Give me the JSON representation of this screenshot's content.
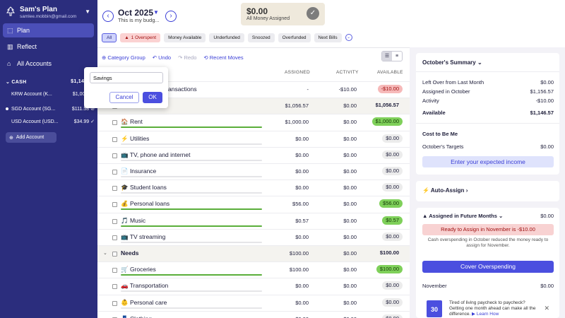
{
  "sidebar": {
    "plan_name": "Sam's Plan",
    "email": "samlee.mobbin@gmail.com",
    "nav": [
      {
        "label": "Plan",
        "icon": "plan-icon"
      },
      {
        "label": "Reflect",
        "icon": "bar-chart-icon"
      },
      {
        "label": "All Accounts",
        "icon": "bank-icon"
      }
    ],
    "cash_label": "CASH",
    "cash_total": "$1,146.57",
    "accounts": [
      {
        "name": "KRW Account (K...",
        "balance": "$1,000.00",
        "status": ""
      },
      {
        "name": "SGD Account (SG...",
        "balance": "$111.58",
        "status": "reconciling-icon"
      },
      {
        "name": "USD Account (USD...",
        "balance": "$34.99",
        "status": "check-icon"
      }
    ],
    "add_account": "Add Account"
  },
  "header": {
    "month": "Oct 2025",
    "note": "This is my budg...",
    "assigned_amount": "$0.00",
    "assigned_label": "All Money Assigned"
  },
  "filters": [
    {
      "label": "All",
      "selected": true
    },
    {
      "label": "1 Overspent",
      "warn": true
    },
    {
      "label": "Money Available"
    },
    {
      "label": "Underfunded"
    },
    {
      "label": "Snoozed"
    },
    {
      "label": "Overfunded"
    },
    {
      "label": "Next Bills"
    }
  ],
  "toolbar": {
    "category_group": "Category Group",
    "undo": "Undo",
    "redo": "Redo",
    "recent_moves": "Recent Moves"
  },
  "columns": {
    "assigned": "ASSIGNED",
    "activity": "ACTIVITY",
    "available": "AVAILABLE"
  },
  "rows": [
    {
      "type": "item",
      "name": "ansactions",
      "assigned": "-",
      "activity": "-$10.00",
      "available": "-$10.00",
      "avail_style": "neg"
    },
    {
      "type": "group",
      "name": "",
      "assigned": "$1,056.57",
      "activity": "$0.00",
      "available": "$1,056.57"
    },
    {
      "type": "item",
      "name": "🏠 Rent",
      "assigned": "$1,000.00",
      "activity": "$0.00",
      "available": "$1,000.00",
      "avail_style": "pos",
      "bar": "green"
    },
    {
      "type": "item",
      "name": "⚡ Utilities",
      "assigned": "$0.00",
      "activity": "$0.00",
      "available": "$0.00"
    },
    {
      "type": "item",
      "name": "📺 TV, phone and internet",
      "assigned": "$0.00",
      "activity": "$0.00",
      "available": "$0.00"
    },
    {
      "type": "item",
      "name": "📄 Insurance",
      "assigned": "$0.00",
      "activity": "$0.00",
      "available": "$0.00"
    },
    {
      "type": "item",
      "name": "🎓 Student loans",
      "assigned": "$0.00",
      "activity": "$0.00",
      "available": "$0.00"
    },
    {
      "type": "item",
      "name": "💰 Personal loans",
      "assigned": "$56.00",
      "activity": "$0.00",
      "available": "$56.00",
      "avail_style": "pos",
      "bar": "green"
    },
    {
      "type": "item",
      "name": "🎵 Music",
      "assigned": "$0.57",
      "activity": "$0.00",
      "available": "$0.57",
      "avail_style": "pos",
      "bar": "green"
    },
    {
      "type": "item",
      "name": "📺 TV streaming",
      "assigned": "$0.00",
      "activity": "$0.00",
      "available": "$0.00"
    },
    {
      "type": "group",
      "name": "Needs",
      "assigned": "$100.00",
      "activity": "$0.00",
      "available": "$100.00"
    },
    {
      "type": "item",
      "name": "🛒 Groceries",
      "assigned": "$100.00",
      "activity": "$0.00",
      "available": "$100.00",
      "avail_style": "pos",
      "bar": "green"
    },
    {
      "type": "item",
      "name": "🚗 Transportation",
      "assigned": "$0.00",
      "activity": "$0.00",
      "available": "$0.00"
    },
    {
      "type": "item",
      "name": "👶 Personal care",
      "assigned": "$0.00",
      "activity": "$0.00",
      "available": "$0.00"
    },
    {
      "type": "item",
      "name": "👖 Clothing",
      "assigned": "$0.00",
      "activity": "$0.00",
      "available": "$0.00"
    }
  ],
  "popup": {
    "input_value": "Savings",
    "cancel": "Cancel",
    "ok": "OK"
  },
  "summary": {
    "title": "October's Summary",
    "lines": [
      {
        "label": "Left Over from Last Month",
        "value": "$0.00"
      },
      {
        "label": "Assigned in October",
        "value": "$1,156.57"
      },
      {
        "label": "Activity",
        "value": "-$10.00"
      },
      {
        "label": "Available",
        "value": "$1,146.57"
      }
    ],
    "cost_title": "Cost to Be Me",
    "targets_label": "October's Targets",
    "targets_value": "$0.00",
    "income_button": "Enter your expected income"
  },
  "auto_assign": {
    "title": "Auto-Assign"
  },
  "future": {
    "title": "Assigned in Future Months",
    "value": "$0.00",
    "ready_text": "Ready to Assign in November is -$10.00",
    "note": "Cash overspending in October reduced the money ready to assign for November.",
    "cover_button": "Cover Overspending",
    "month_label": "November",
    "month_value": "$0.00"
  },
  "tip": {
    "calendar_day": "30",
    "text": "Tired of living paycheck to paycheck? Getting one month ahead can make all the difference.",
    "link": "Learn How"
  }
}
